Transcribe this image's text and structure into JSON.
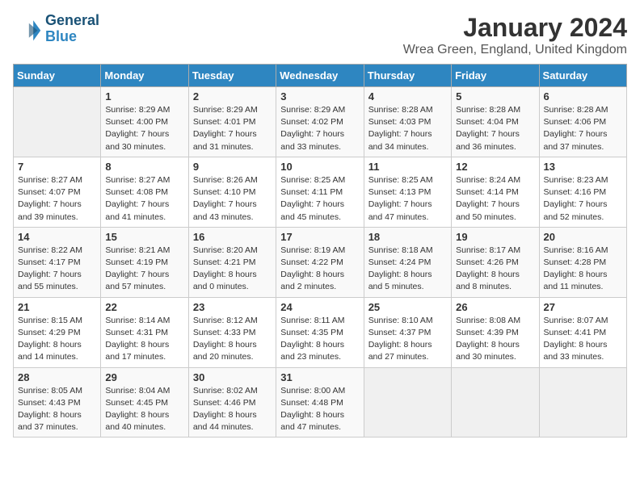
{
  "header": {
    "logo_line1": "General",
    "logo_line2": "Blue",
    "month_title": "January 2024",
    "subtitle": "Wrea Green, England, United Kingdom"
  },
  "weekdays": [
    "Sunday",
    "Monday",
    "Tuesday",
    "Wednesday",
    "Thursday",
    "Friday",
    "Saturday"
  ],
  "weeks": [
    [
      {
        "day": "",
        "detail": ""
      },
      {
        "day": "1",
        "detail": "Sunrise: 8:29 AM\nSunset: 4:00 PM\nDaylight: 7 hours\nand 30 minutes."
      },
      {
        "day": "2",
        "detail": "Sunrise: 8:29 AM\nSunset: 4:01 PM\nDaylight: 7 hours\nand 31 minutes."
      },
      {
        "day": "3",
        "detail": "Sunrise: 8:29 AM\nSunset: 4:02 PM\nDaylight: 7 hours\nand 33 minutes."
      },
      {
        "day": "4",
        "detail": "Sunrise: 8:28 AM\nSunset: 4:03 PM\nDaylight: 7 hours\nand 34 minutes."
      },
      {
        "day": "5",
        "detail": "Sunrise: 8:28 AM\nSunset: 4:04 PM\nDaylight: 7 hours\nand 36 minutes."
      },
      {
        "day": "6",
        "detail": "Sunrise: 8:28 AM\nSunset: 4:06 PM\nDaylight: 7 hours\nand 37 minutes."
      }
    ],
    [
      {
        "day": "7",
        "detail": "Sunrise: 8:27 AM\nSunset: 4:07 PM\nDaylight: 7 hours\nand 39 minutes."
      },
      {
        "day": "8",
        "detail": "Sunrise: 8:27 AM\nSunset: 4:08 PM\nDaylight: 7 hours\nand 41 minutes."
      },
      {
        "day": "9",
        "detail": "Sunrise: 8:26 AM\nSunset: 4:10 PM\nDaylight: 7 hours\nand 43 minutes."
      },
      {
        "day": "10",
        "detail": "Sunrise: 8:25 AM\nSunset: 4:11 PM\nDaylight: 7 hours\nand 45 minutes."
      },
      {
        "day": "11",
        "detail": "Sunrise: 8:25 AM\nSunset: 4:13 PM\nDaylight: 7 hours\nand 47 minutes."
      },
      {
        "day": "12",
        "detail": "Sunrise: 8:24 AM\nSunset: 4:14 PM\nDaylight: 7 hours\nand 50 minutes."
      },
      {
        "day": "13",
        "detail": "Sunrise: 8:23 AM\nSunset: 4:16 PM\nDaylight: 7 hours\nand 52 minutes."
      }
    ],
    [
      {
        "day": "14",
        "detail": "Sunrise: 8:22 AM\nSunset: 4:17 PM\nDaylight: 7 hours\nand 55 minutes."
      },
      {
        "day": "15",
        "detail": "Sunrise: 8:21 AM\nSunset: 4:19 PM\nDaylight: 7 hours\nand 57 minutes."
      },
      {
        "day": "16",
        "detail": "Sunrise: 8:20 AM\nSunset: 4:21 PM\nDaylight: 8 hours\nand 0 minutes."
      },
      {
        "day": "17",
        "detail": "Sunrise: 8:19 AM\nSunset: 4:22 PM\nDaylight: 8 hours\nand 2 minutes."
      },
      {
        "day": "18",
        "detail": "Sunrise: 8:18 AM\nSunset: 4:24 PM\nDaylight: 8 hours\nand 5 minutes."
      },
      {
        "day": "19",
        "detail": "Sunrise: 8:17 AM\nSunset: 4:26 PM\nDaylight: 8 hours\nand 8 minutes."
      },
      {
        "day": "20",
        "detail": "Sunrise: 8:16 AM\nSunset: 4:28 PM\nDaylight: 8 hours\nand 11 minutes."
      }
    ],
    [
      {
        "day": "21",
        "detail": "Sunrise: 8:15 AM\nSunset: 4:29 PM\nDaylight: 8 hours\nand 14 minutes."
      },
      {
        "day": "22",
        "detail": "Sunrise: 8:14 AM\nSunset: 4:31 PM\nDaylight: 8 hours\nand 17 minutes."
      },
      {
        "day": "23",
        "detail": "Sunrise: 8:12 AM\nSunset: 4:33 PM\nDaylight: 8 hours\nand 20 minutes."
      },
      {
        "day": "24",
        "detail": "Sunrise: 8:11 AM\nSunset: 4:35 PM\nDaylight: 8 hours\nand 23 minutes."
      },
      {
        "day": "25",
        "detail": "Sunrise: 8:10 AM\nSunset: 4:37 PM\nDaylight: 8 hours\nand 27 minutes."
      },
      {
        "day": "26",
        "detail": "Sunrise: 8:08 AM\nSunset: 4:39 PM\nDaylight: 8 hours\nand 30 minutes."
      },
      {
        "day": "27",
        "detail": "Sunrise: 8:07 AM\nSunset: 4:41 PM\nDaylight: 8 hours\nand 33 minutes."
      }
    ],
    [
      {
        "day": "28",
        "detail": "Sunrise: 8:05 AM\nSunset: 4:43 PM\nDaylight: 8 hours\nand 37 minutes."
      },
      {
        "day": "29",
        "detail": "Sunrise: 8:04 AM\nSunset: 4:45 PM\nDaylight: 8 hours\nand 40 minutes."
      },
      {
        "day": "30",
        "detail": "Sunrise: 8:02 AM\nSunset: 4:46 PM\nDaylight: 8 hours\nand 44 minutes."
      },
      {
        "day": "31",
        "detail": "Sunrise: 8:00 AM\nSunset: 4:48 PM\nDaylight: 8 hours\nand 47 minutes."
      },
      {
        "day": "",
        "detail": ""
      },
      {
        "day": "",
        "detail": ""
      },
      {
        "day": "",
        "detail": ""
      }
    ]
  ]
}
